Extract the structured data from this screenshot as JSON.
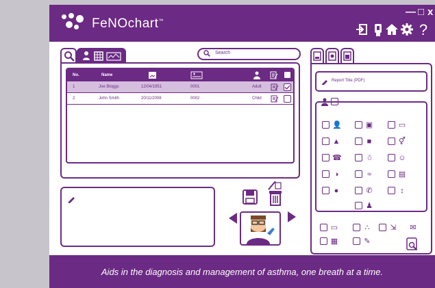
{
  "app": {
    "name": "FeNOchart",
    "trademark": "™",
    "window_controls": {
      "minimize": "—",
      "maximize": "□",
      "close": "x"
    },
    "header_icons": [
      "logout-icon",
      "usb-icon",
      "home-icon",
      "gear-icon",
      "help-icon"
    ],
    "help_glyph": "?"
  },
  "search": {
    "placeholder": "Search"
  },
  "table": {
    "headers": {
      "no": "No.",
      "name": "Name"
    },
    "rows": [
      {
        "no": "1",
        "name": "Joe Bloggs",
        "dob": "12/04/1951",
        "id": "0001",
        "type": "Adult",
        "selected": true,
        "checked": true
      },
      {
        "no": "2",
        "name": "John Smith",
        "dob": "20/11/2008",
        "id": "0002",
        "type": "Child",
        "selected": false,
        "checked": false
      }
    ]
  },
  "report": {
    "title_placeholder": "Report Title (PDF)"
  },
  "footer": {
    "tagline": "Aids in the diagnosis and management of asthma, one breath at a time."
  },
  "colors": {
    "brand": "#6b2a83",
    "row_selected": "#d6bedf",
    "background": "#c8c4cc"
  }
}
